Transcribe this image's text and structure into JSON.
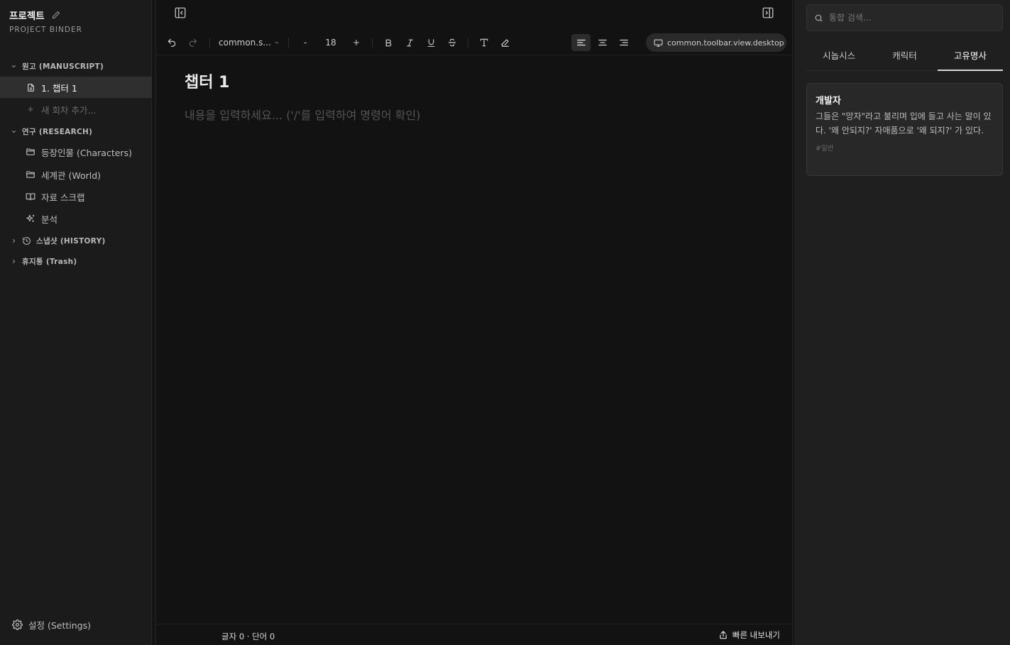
{
  "sidebar": {
    "project_title": "프로젝트",
    "project_subtitle": "PROJECT BINDER",
    "manuscript_header": "원고 (MANUSCRIPT)",
    "chapter_item": "1. 챕터 1",
    "add_chapter": "새 회차 추가...",
    "research_header": "연구 (RESEARCH)",
    "research_items": [
      {
        "label": "등장인물 (Characters)",
        "icon": "folder-icon"
      },
      {
        "label": "세계관 (World)",
        "icon": "folder-icon"
      },
      {
        "label": "자료 스크랩",
        "icon": "book-icon"
      },
      {
        "label": "분석",
        "icon": "sparkles-icon"
      }
    ],
    "history_header": "스냅샷 (HISTORY)",
    "trash_header": "휴지통 (Trash)",
    "settings_label": "설정 (Settings)"
  },
  "toolbar": {
    "font_select": "common.s...",
    "size_decrease": "-",
    "font_size": "18",
    "size_increase": "+",
    "view_mode": "common.toolbar.view.desktop"
  },
  "document": {
    "title": "챕터 1",
    "placeholder": "내용을 입력하세요... ('/'를 입력하여 명령어 확인)"
  },
  "footer": {
    "count": "글자 0 · 단어 0",
    "export_label": "빠른 내보내기"
  },
  "right_panel": {
    "search_placeholder": "통합 검색...",
    "tabs": [
      "시놉시스",
      "캐릭터",
      "고유명사"
    ],
    "active_tab": "고유명사",
    "card": {
      "title": "개발자",
      "description": "그들은 \"망자\"라고 불리며 입에 들고 사는 말이 있다. '왜 안되지?' 자매품으로 '왜 되지?' 가 있다.",
      "tag": "#일반"
    }
  },
  "colors": {
    "background": "#141414",
    "sidebar": "#1b1b1b",
    "active_item": "#2f2f2f",
    "panel": "#1f1f1f"
  }
}
